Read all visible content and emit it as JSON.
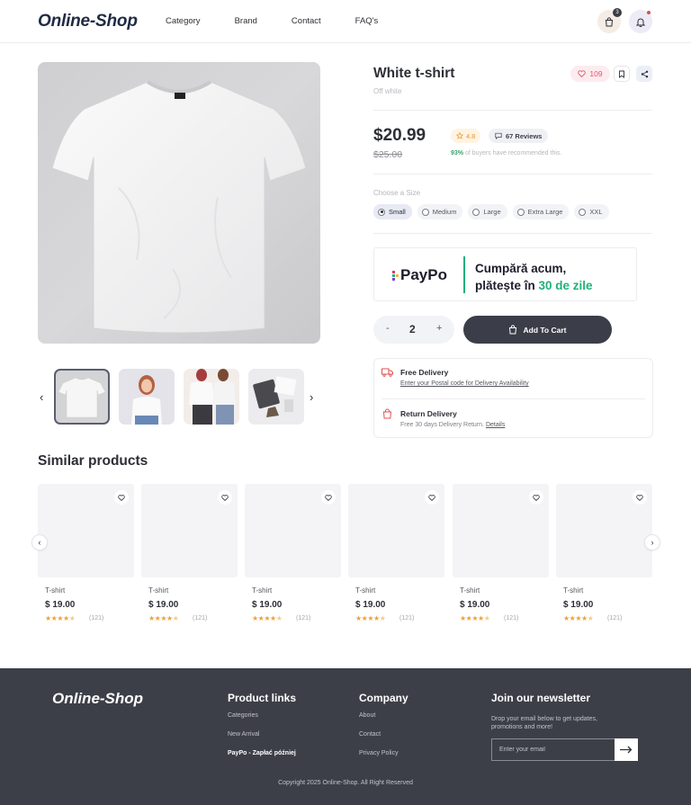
{
  "header": {
    "logo": "Online-Shop",
    "nav": [
      "Category",
      "Brand",
      "Contact",
      "FAQ's"
    ],
    "cart_count": "3"
  },
  "product": {
    "title": "White t-shirt",
    "subtitle": "Off white",
    "likes": "109",
    "price": "$20.99",
    "old_price": "$25.00",
    "rating": "4.8",
    "reviews": "67 Reviews",
    "recommend_pct": "93%",
    "recommend_text": " of buyers have recommended this.",
    "size_label": "Choose a Size",
    "sizes": [
      "Small",
      "Medium",
      "Large",
      "Extra Large",
      "XXL"
    ],
    "selected_size": "Small",
    "quantity": "2",
    "add_to_cart": "Add To Cart"
  },
  "paypo": {
    "logo": "PayPo",
    "line1": "Cumpără acum,",
    "line2_pre": "plătește în ",
    "line2_highlight": "30 de zile"
  },
  "delivery": {
    "free_title": "Free Delivery",
    "free_desc": "Enter your Postal code for Delivery Availability",
    "return_title": "Return Delivery",
    "return_desc": "Free 30 days Delivery Return. ",
    "return_link": "Details"
  },
  "similar": {
    "title": "Similar products",
    "items": [
      {
        "name": "T-shirt",
        "price": "$ 19.00",
        "count": "(121)",
        "rating": 4.5
      },
      {
        "name": "T-shirt",
        "price": "$ 19.00",
        "count": "(121)",
        "rating": 4.5
      },
      {
        "name": "T-shirt",
        "price": "$ 19.00",
        "count": "(121)",
        "rating": 4.5
      },
      {
        "name": "T-shirt",
        "price": "$ 19.00",
        "count": "(121)",
        "rating": 4.5
      },
      {
        "name": "T-shirt",
        "price": "$ 19.00",
        "count": "(121)",
        "rating": 4.5
      },
      {
        "name": "T-shirt",
        "price": "$ 19.00",
        "count": "(121)",
        "rating": 4.5
      }
    ]
  },
  "footer": {
    "logo": "Online-Shop",
    "product_links_title": "Product links",
    "product_links": [
      "Categories",
      "New Arrival",
      "PayPo - Zapłać później"
    ],
    "company_title": "Company",
    "company_links": [
      "About",
      "Contact",
      "Privacy Policy"
    ],
    "newsletter_title": "Join our newsletter",
    "newsletter_desc": "Drop your email below to get updates, promotions and more!",
    "email_placeholder": "Enter your email",
    "copyright": "Copyright 2025 Online-Shop. All Right Reserved"
  },
  "colors": {
    "brand_dark": "#3b3e48",
    "accent_green": "#21b07a",
    "star": "#e9a43a",
    "heart": "#e0566d"
  }
}
